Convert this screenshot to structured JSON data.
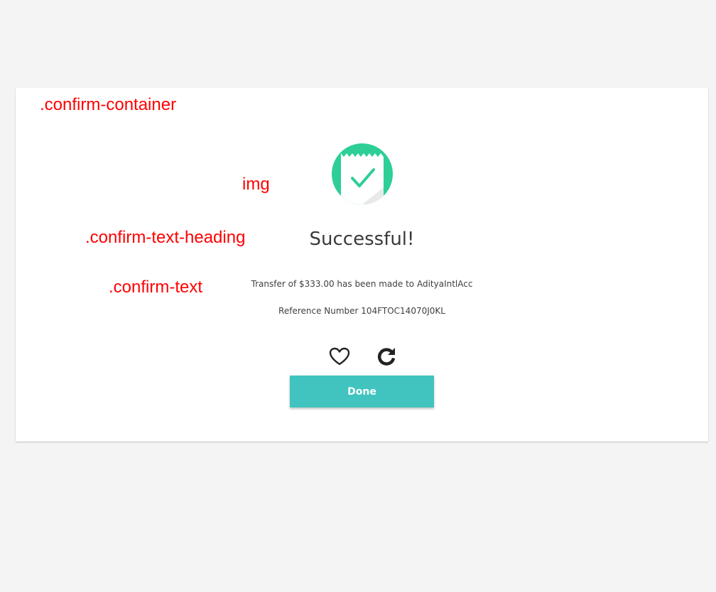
{
  "annotations": {
    "container": ".confirm-container",
    "img": "img",
    "heading": ".confirm-text-heading",
    "text": ".confirm-text"
  },
  "confirm": {
    "heading": "Successful!",
    "message": "Transfer of $333.00 has been made to AdityaIntlAcc",
    "reference": "Reference Number 104FTOC14070J0KL",
    "done_label": "Done"
  },
  "icons": {
    "success": "receipt-check-icon",
    "favorite": "heart-outline-icon",
    "repeat": "redo-icon"
  },
  "colors": {
    "annotation": "#ff0000",
    "success_circle": "#2ecf96",
    "button": "#41c4bf",
    "page_background": "#f4f4f4"
  }
}
